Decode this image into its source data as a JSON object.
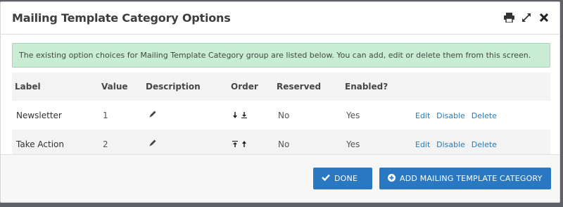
{
  "dialog": {
    "title": "Mailing Template Category Options"
  },
  "alert": {
    "text": "The existing option choices for Mailing Template Category group are listed below. You can add, edit or delete them from this screen."
  },
  "table": {
    "headers": [
      "Label",
      "Value",
      "Description",
      "Order",
      "Reserved",
      "Enabled?"
    ],
    "rows": [
      {
        "label": "Newsletter",
        "value": "1",
        "reserved": "No",
        "enabled": "Yes",
        "actions": [
          "Edit",
          "Disable",
          "Delete"
        ]
      },
      {
        "label": "Take Action",
        "value": "2",
        "reserved": "No",
        "enabled": "Yes",
        "actions": [
          "Edit",
          "Disable",
          "Delete"
        ]
      }
    ]
  },
  "footer": {
    "done_label": "DONE",
    "add_label": "ADD MAILING TEMPLATE CATEGORY"
  },
  "icons": {
    "print": "print-icon",
    "expand": "expand-icon",
    "close": "close-icon",
    "edit_description": "pencil-icon",
    "order_down": "arrow-down-icon",
    "order_bottom": "arrow-bottom-icon",
    "order_top": "arrow-top-icon",
    "order_up": "arrow-up-icon",
    "check": "check-icon",
    "plus": "plus-circle-icon"
  },
  "colors": {
    "primary": "#2b78c2",
    "link": "#2a79b5",
    "alert_bg": "#c9ecd5"
  }
}
